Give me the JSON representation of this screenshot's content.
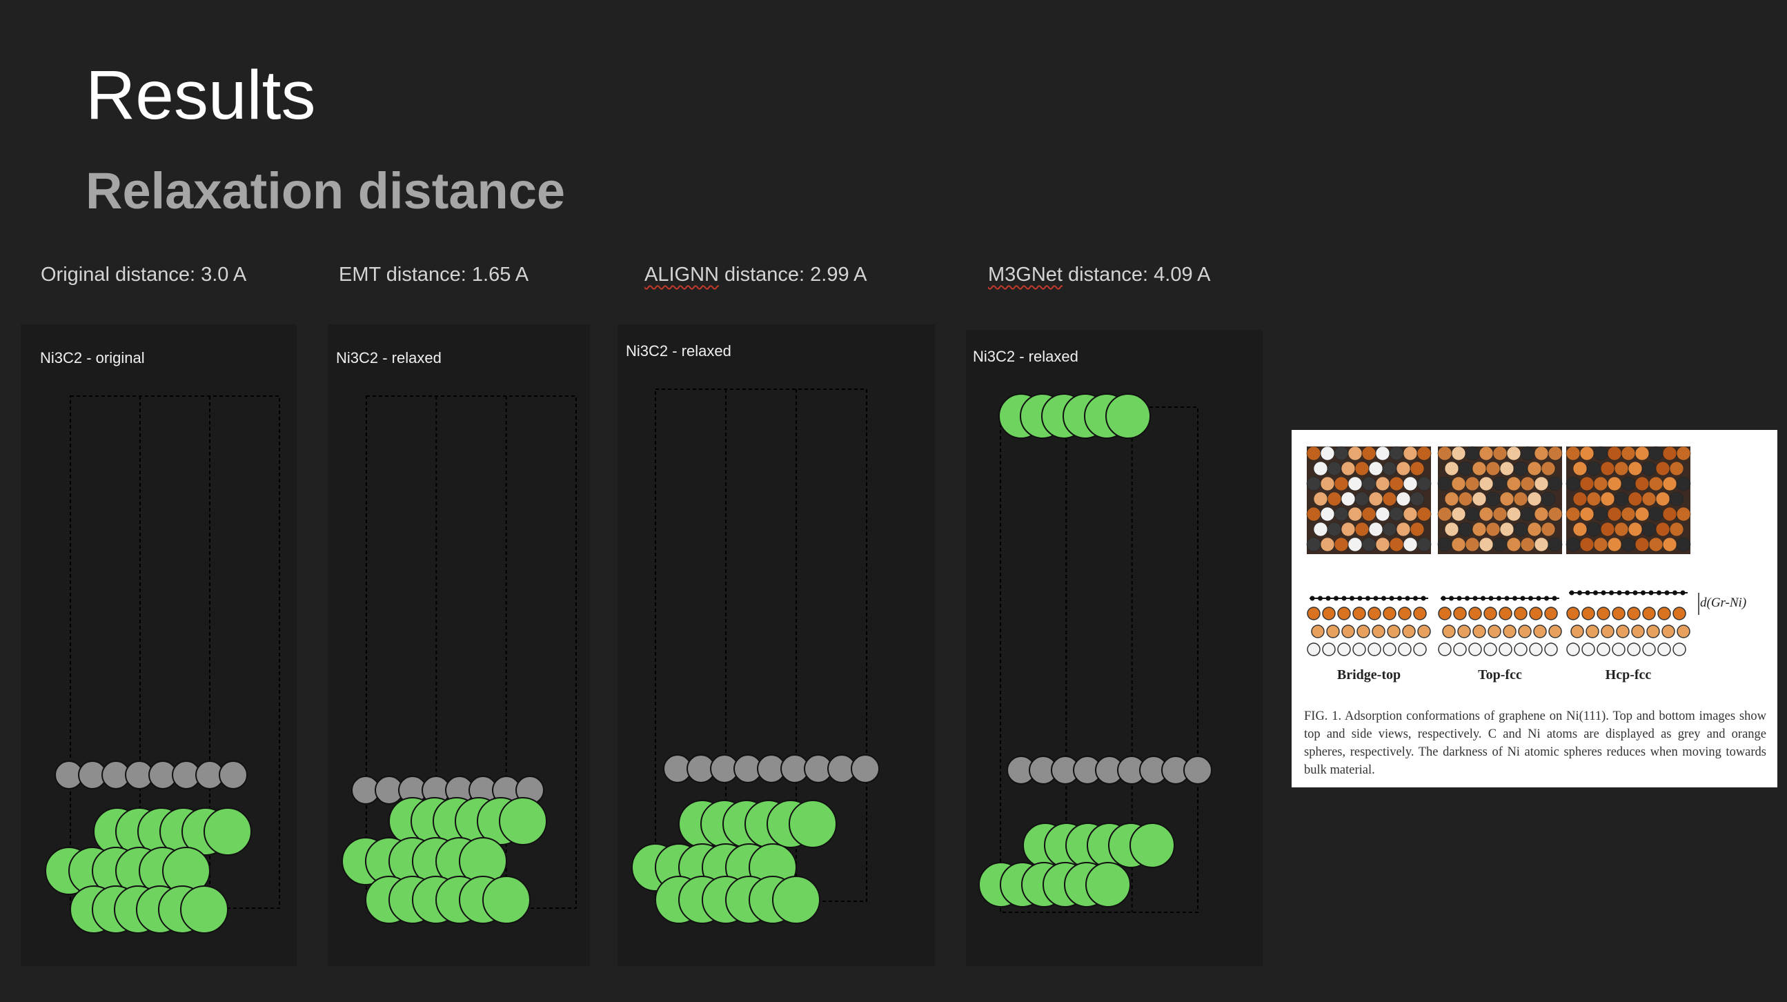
{
  "slide": {
    "title": "Results",
    "subtitle": "Relaxation distance"
  },
  "distances": [
    {
      "label": "Original distance: 3.0 A"
    },
    {
      "prefix": "EMT",
      "suffix": " distance: 1.65 A"
    },
    {
      "prefix": "ALIGNN",
      "suffix": " distance: 2.99 A"
    },
    {
      "prefix": "M3GNet",
      "suffix": " distance: 4.09 A"
    }
  ],
  "panels": [
    {
      "label": "Ni3C2 - original"
    },
    {
      "label": "Ni3C2 - relaxed"
    },
    {
      "label": "Ni3C2 - relaxed"
    },
    {
      "label": "Ni3C2 - relaxed"
    }
  ],
  "colors": {
    "background": "#212121",
    "panel": "#1b1b1b",
    "nickel": "#6fd35f",
    "carbon": "#8e8e8e",
    "subtitle": "#a6a6a6"
  },
  "figure": {
    "sublabels": [
      "Bridge-top",
      "Top-fcc",
      "Hcp-fcc"
    ],
    "d_label": "d(Gr-Ni)",
    "caption": "FIG. 1.  Adsorption conformations of graphene on Ni(111). Top and bottom images show top and side views, respectively. C and Ni atoms are displayed as grey and orange spheres, respectively. The darkness of Ni atomic spheres reduces when moving towards bulk material."
  }
}
